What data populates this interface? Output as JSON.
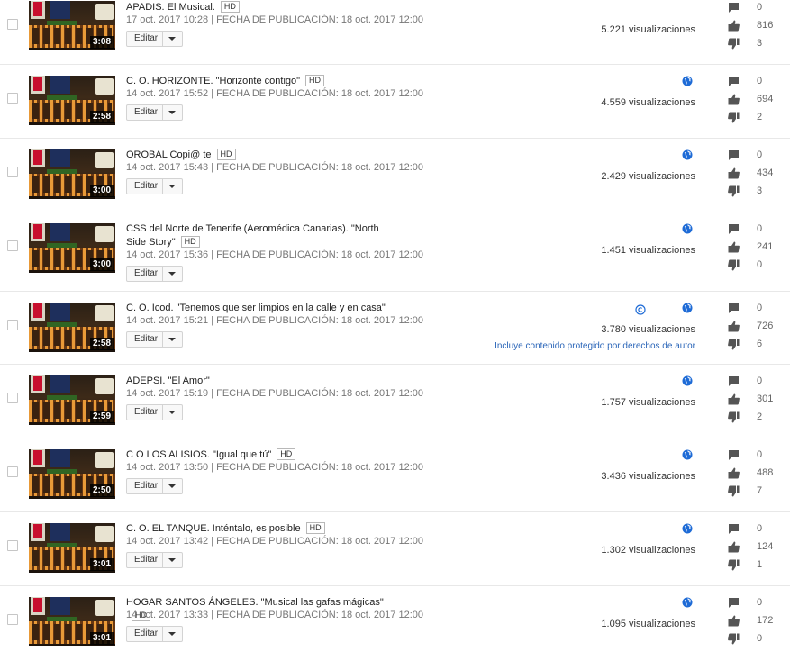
{
  "colors": {
    "accent": "#1e6bd6",
    "link": "#2a65b8",
    "separator": "#e8e8e8"
  },
  "icons": {
    "globe": "globe-icon",
    "copyright": "copyright-icon",
    "comment": "comment-icon",
    "like": "thumbs-up-icon",
    "dislike": "thumbs-down-icon",
    "dropdown": "caret-down-icon"
  },
  "edit_label": "Editar",
  "views_suffix": "visualizaciones",
  "videos": [
    {
      "title": "APADIS. El Musical.",
      "hd": "HD",
      "meta": "17 oct. 2017 10:28 | FECHA DE PUBLICACIÓN: 18 oct. 2017 12:00",
      "duration": "3:08",
      "views": "5.221 visualizaciones",
      "comments": "0",
      "likes": "816",
      "dislikes": "3",
      "copyright": false,
      "claim": ""
    },
    {
      "title": "C. O. HORIZONTE. \"Horizonte contigo\"",
      "hd": "HD",
      "meta": "14 oct. 2017 15:52 | FECHA DE PUBLICACIÓN: 18 oct. 2017 12:00",
      "duration": "2:58",
      "views": "4.559 visualizaciones",
      "comments": "0",
      "likes": "694",
      "dislikes": "2",
      "copyright": false,
      "claim": ""
    },
    {
      "title": "OROBAL Copi@ te",
      "hd": "HD",
      "meta": "14 oct. 2017 15:43 | FECHA DE PUBLICACIÓN: 18 oct. 2017 12:00",
      "duration": "3:00",
      "views": "2.429 visualizaciones",
      "comments": "0",
      "likes": "434",
      "dislikes": "3",
      "copyright": false,
      "claim": ""
    },
    {
      "title": "CSS del Norte de Tenerife (Aeromédica Canarias). \"North Side Story\"",
      "hd": "HD",
      "meta": "14 oct. 2017 15:36 | FECHA DE PUBLICACIÓN: 18 oct. 2017 12:00",
      "duration": "3:00",
      "views": "1.451 visualizaciones",
      "comments": "0",
      "likes": "241",
      "dislikes": "0",
      "copyright": false,
      "claim": ""
    },
    {
      "title": "C. O. Icod. \"Tenemos que ser limpios en la calle y en casa\"",
      "hd": "",
      "meta": "14 oct. 2017 15:21 | FECHA DE PUBLICACIÓN: 18 oct. 2017 12:00",
      "duration": "2:58",
      "views": "3.780 visualizaciones",
      "comments": "0",
      "likes": "726",
      "dislikes": "6",
      "copyright": true,
      "claim": "Incluye contenido protegido por derechos de autor"
    },
    {
      "title": "ADEPSI. \"El Amor\"",
      "hd": "",
      "meta": "14 oct. 2017 15:19 | FECHA DE PUBLICACIÓN: 18 oct. 2017 12:00",
      "duration": "2:59",
      "views": "1.757 visualizaciones",
      "comments": "0",
      "likes": "301",
      "dislikes": "2",
      "copyright": false,
      "claim": ""
    },
    {
      "title": "C O LOS ALISIOS. \"Igual que tú\"",
      "hd": "HD",
      "meta": "14 oct. 2017 13:50 | FECHA DE PUBLICACIÓN: 18 oct. 2017 12:00",
      "duration": "2:50",
      "views": "3.436 visualizaciones",
      "comments": "0",
      "likes": "488",
      "dislikes": "7",
      "copyright": false,
      "claim": ""
    },
    {
      "title": "C. O. EL TANQUE. Inténtalo, es posible",
      "hd": "HD",
      "meta": "14 oct. 2017 13:42 | FECHA DE PUBLICACIÓN: 18 oct. 2017 12:00",
      "duration": "3:01",
      "views": "1.302 visualizaciones",
      "comments": "0",
      "likes": "124",
      "dislikes": "1",
      "copyright": false,
      "claim": ""
    },
    {
      "title": "HOGAR SANTOS ÁNGELES. \"Musical las gafas mágicas\"",
      "hd": "HD",
      "meta": "14 oct. 2017 13:33 | FECHA DE PUBLICACIÓN: 18 oct. 2017 12:00",
      "duration": "3:01",
      "views": "1.095 visualizaciones",
      "comments": "0",
      "likes": "172",
      "dislikes": "0",
      "copyright": false,
      "claim": ""
    }
  ]
}
